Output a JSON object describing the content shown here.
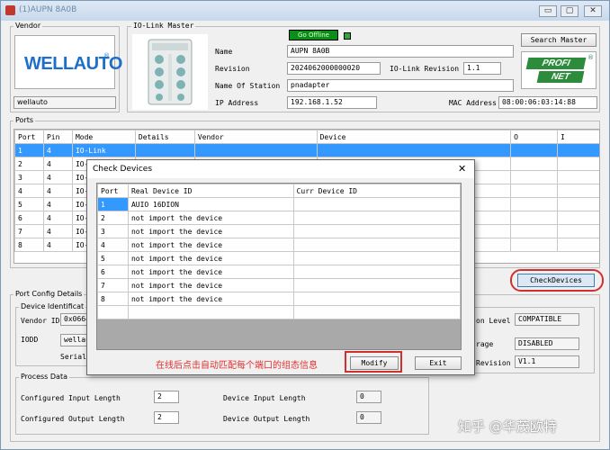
{
  "window": {
    "title": "(1)AUPN 8A0B",
    "min_label": "▭",
    "max_label": "▢",
    "close_label": "✕"
  },
  "vendor": {
    "group_label": "Vendor",
    "logo_text": "WELLAUTO",
    "logo_mark": "®",
    "name_value": "wellauto"
  },
  "iolink": {
    "group_label": "IO-Link Master",
    "status": "Go Offline",
    "name_label": "Name",
    "name_value": "AUPN 8A0B",
    "revision_label": "Revision",
    "revision_value": "2024062000000020",
    "iolink_rev_label": "IO-Link Revision",
    "iolink_rev_value": "1.1",
    "station_label": "Name Of Station",
    "station_value": "pnadapter",
    "ip_label": "IP Address",
    "ip_value": "192.168.1.52",
    "mac_label": "MAC Address",
    "mac_value": "08:00:06:03:14:88",
    "search_button": "Search Master",
    "profinet_top": "PROFI",
    "profinet_bottom": "NET",
    "profinet_mark": "®"
  },
  "ports": {
    "group_label": "Ports",
    "columns": [
      "Port",
      "Pin",
      "Mode",
      "Details",
      "Vendor",
      "Device",
      "O",
      "I"
    ],
    "rows": [
      [
        "1",
        "4",
        "IO-Link"
      ],
      [
        "2",
        "4",
        "IO-L"
      ],
      [
        "3",
        "4",
        "IO-L"
      ],
      [
        "4",
        "4",
        "IO-L"
      ],
      [
        "5",
        "4",
        "IO-L"
      ],
      [
        "6",
        "4",
        "IO-L"
      ],
      [
        "7",
        "4",
        "IO-L"
      ],
      [
        "8",
        "4",
        "IO-L"
      ]
    ],
    "check_button": "CheckDevices"
  },
  "port_config": {
    "group_label": "Port Config Details",
    "device_ident_label": "Device Identificat",
    "vendor_id_label": "Vendor ID",
    "vendor_id_value": "0x066e",
    "iodd_label": "IODD",
    "iodd_value": "wellau",
    "serial_label": "Serial",
    "ion_level_label": "on Level",
    "ion_level_value": "COMPATIBLE",
    "storage_label": "rage",
    "storage_value": "DISABLED",
    "revision_label": "Revision",
    "revision_value": "V1.1"
  },
  "process": {
    "group_label": "Process Data",
    "cfg_in_label": "Configured Input Length",
    "cfg_in_value": "2",
    "cfg_out_label": "Configured Output Length",
    "cfg_out_value": "2",
    "dev_in_label": "Device Input Length",
    "dev_in_value": "0",
    "dev_out_label": "Device Output Length",
    "dev_out_value": "0"
  },
  "dialog": {
    "title": "Check Devices",
    "close_label": "✕",
    "columns": [
      "Port",
      "Real Device ID",
      "Curr Device ID"
    ],
    "rows": [
      [
        "1",
        "AUIO 16DION",
        ""
      ],
      [
        "2",
        "not import the device",
        ""
      ],
      [
        "3",
        "not import the device",
        ""
      ],
      [
        "4",
        "not import the device",
        ""
      ],
      [
        "5",
        "not import the device",
        ""
      ],
      [
        "6",
        "not import the device",
        ""
      ],
      [
        "7",
        "not import the device",
        ""
      ],
      [
        "8",
        "not import the device",
        ""
      ]
    ],
    "annotation": "在线后点击自动匹配每个端口的组态信息",
    "modify_button": "Modify",
    "exit_button": "Exit"
  },
  "watermark": "知乎 @华茂欧特",
  "colors": {
    "accent_select": "#3399ff",
    "annotation": "#e03030",
    "status_green": "#0a8a0a",
    "logo_blue": "#1e6fc9",
    "profinet_green": "#2c8c3c"
  }
}
